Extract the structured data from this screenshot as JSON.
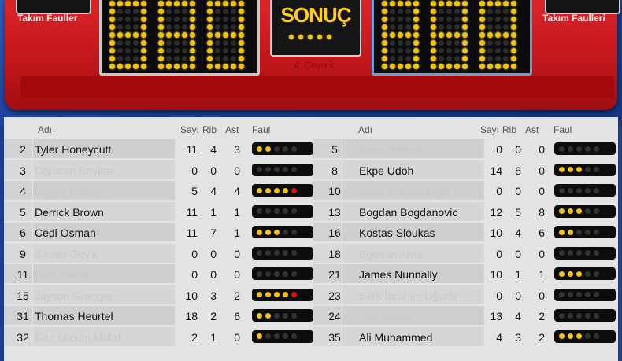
{
  "scoreboard": {
    "left_fouls_label": "Takım Fauller",
    "right_fouls_label": "Takım Faulleri",
    "home_score_digits": [
      "8",
      "8",
      "8"
    ],
    "away_score_digits": [
      "8",
      "8",
      "8"
    ],
    "status_label": "SONUÇ",
    "period_label": "4. Çeyrek"
  },
  "table": {
    "headers": {
      "name": "Adı",
      "points": "Sayı",
      "rebounds": "Rib",
      "assists": "Ast",
      "fouls": "Faul"
    },
    "home": [
      {
        "num": "2",
        "name": "Tyler Honeycutt",
        "pts": "11",
        "reb": "4",
        "ast": "3",
        "fouls": 2,
        "dim": false
      },
      {
        "num": "3",
        "name": "Oğulcan Baykan",
        "pts": "0",
        "reb": "0",
        "ast": "0",
        "fouls": 0,
        "dim": true
      },
      {
        "num": "4",
        "name": "Doğuş Balbay",
        "pts": "5",
        "reb": "4",
        "ast": "4",
        "fouls": 5,
        "dim": true
      },
      {
        "num": "5",
        "name": "Derrick Brown",
        "pts": "11",
        "reb": "1",
        "ast": "1",
        "fouls": 0,
        "dim": false
      },
      {
        "num": "6",
        "name": "Cedi Osman",
        "pts": "11",
        "reb": "7",
        "ast": "1",
        "fouls": 3,
        "dim": false
      },
      {
        "num": "9",
        "name": "Samet Geyik",
        "pts": "0",
        "reb": "0",
        "ast": "0",
        "fouls": 0,
        "dim": true
      },
      {
        "num": "11",
        "name": "Berk Demir",
        "pts": "0",
        "reb": "0",
        "ast": "0",
        "fouls": 0,
        "dim": true
      },
      {
        "num": "15",
        "name": "Jayson Granger",
        "pts": "10",
        "reb": "3",
        "ast": "2",
        "fouls": 5,
        "dim": true
      },
      {
        "num": "31",
        "name": "Thomas Heurtel",
        "pts": "18",
        "reb": "2",
        "ast": "6",
        "fouls": 2,
        "dim": false
      },
      {
        "num": "32",
        "name": "Can Maxim Mutaf",
        "pts": "2",
        "reb": "1",
        "ast": "0",
        "fouls": 1,
        "dim": true
      }
    ],
    "away": [
      {
        "num": "5",
        "name": "Barış Hersek",
        "pts": "0",
        "reb": "0",
        "ast": "0",
        "fouls": 0,
        "dim": true
      },
      {
        "num": "8",
        "name": "Ekpe Udoh",
        "pts": "14",
        "reb": "8",
        "ast": "0",
        "fouls": 3,
        "dim": false
      },
      {
        "num": "10",
        "name": "Melih Mahmutoğlu",
        "pts": "0",
        "reb": "0",
        "ast": "0",
        "fouls": 0,
        "dim": true
      },
      {
        "num": "13",
        "name": "Bogdan Bogdanovic",
        "pts": "12",
        "reb": "5",
        "ast": "8",
        "fouls": 3,
        "dim": false
      },
      {
        "num": "16",
        "name": "Kostas Sloukas",
        "pts": "10",
        "reb": "4",
        "ast": "6",
        "fouls": 2,
        "dim": false
      },
      {
        "num": "18",
        "name": "Egehan Arna",
        "pts": "0",
        "reb": "0",
        "ast": "0",
        "fouls": 0,
        "dim": true
      },
      {
        "num": "21",
        "name": "James Nunnally",
        "pts": "10",
        "reb": "1",
        "ast": "1",
        "fouls": 3,
        "dim": false
      },
      {
        "num": "23",
        "name": "Berk İbrahim Uğurlu",
        "pts": "0",
        "reb": "0",
        "ast": "0",
        "fouls": 0,
        "dim": true
      },
      {
        "num": "24",
        "name": "Jan Vesely",
        "pts": "13",
        "reb": "4",
        "ast": "2",
        "fouls": 0,
        "dim": true
      },
      {
        "num": "35",
        "name": "Ali Muhammed",
        "pts": "4",
        "reb": "3",
        "ast": "2",
        "fouls": 3,
        "dim": false
      }
    ]
  },
  "colors": {
    "foul_yellow": "#f5c412",
    "foul_red": "#e01010",
    "board_red": "#c1161b",
    "led_yellow": "#f2c20c"
  }
}
